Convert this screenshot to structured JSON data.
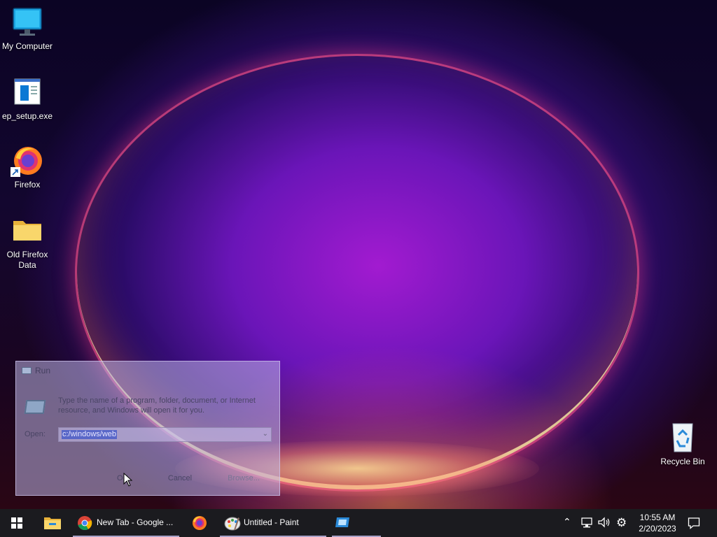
{
  "desktop": {
    "icons": [
      {
        "label": "My Computer",
        "icon": "monitor-icon"
      },
      {
        "label": "ep_setup.exe",
        "icon": "installer-icon"
      },
      {
        "label": "Firefox",
        "icon": "firefox-icon"
      },
      {
        "label": "Old Firefox Data",
        "icon": "folder-icon"
      },
      {
        "label": "Recycle Bin",
        "icon": "recycle-bin-icon"
      }
    ]
  },
  "run_dialog": {
    "title": "Run",
    "description": "Type the name of a program, folder, document, or Internet resource, and Windows will open it for you.",
    "open_label": "Open:",
    "open_value": "c:/windows/web",
    "buttons": {
      "ok": "OK",
      "cancel": "Cancel",
      "browse": "Browse..."
    }
  },
  "taskbar": {
    "apps": [
      {
        "label": "",
        "icon": "file-explorer-icon"
      },
      {
        "label": "New Tab - Google ...",
        "icon": "chrome-icon",
        "active": true
      },
      {
        "label": "",
        "icon": "firefox-icon"
      },
      {
        "label": "Untitled - Paint",
        "icon": "paint-icon",
        "active": true
      },
      {
        "label": "",
        "icon": "remote-desktop-icon",
        "active": true
      }
    ],
    "clock": {
      "time": "10:55 AM",
      "date": "2/20/2023"
    }
  }
}
